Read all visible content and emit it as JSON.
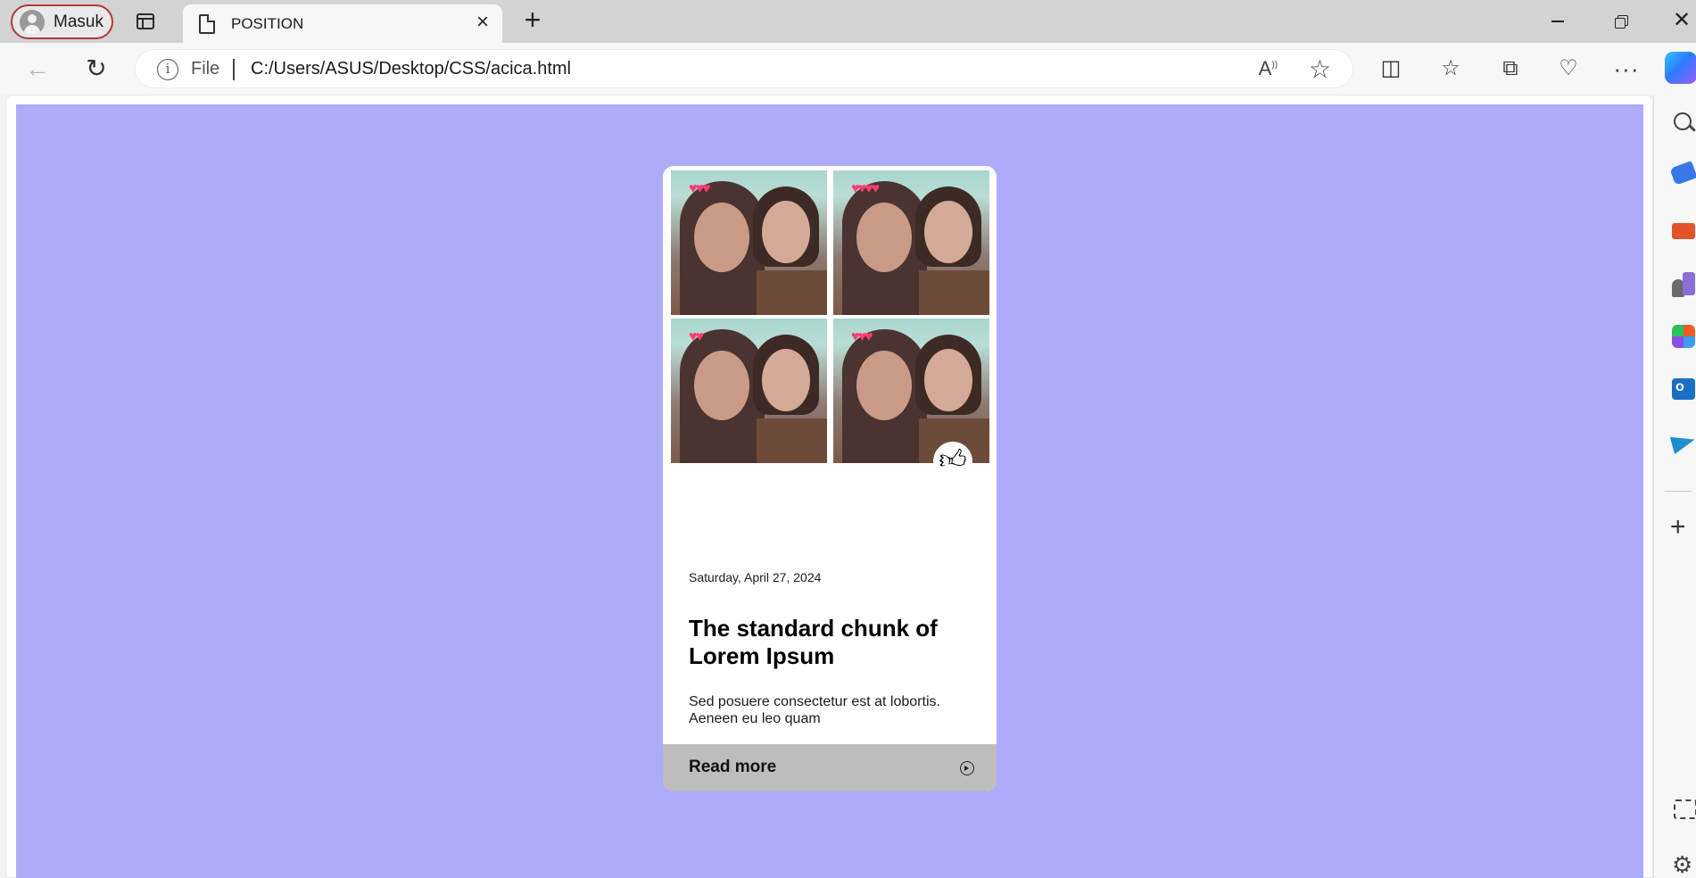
{
  "browser": {
    "profile_label": "Masuk",
    "tab_title": "POSITION",
    "address_scheme": "File",
    "address_url": "C:/Users/ASUS/Desktop/CSS/acica.html",
    "icons": [
      "profile-avatar-icon",
      "tab-actions-icon",
      "page-icon",
      "close-icon",
      "new-tab-icon",
      "back-icon",
      "refresh-icon",
      "info-icon",
      "read-aloud-icon",
      "favorite-star-icon",
      "split-screen-icon",
      "favorites-icon",
      "collections-icon",
      "browser-essentials-icon",
      "more-icon",
      "copilot-icon"
    ]
  },
  "sidebar": {
    "icons": [
      "search-icon",
      "shopping-tag-icon",
      "tools-icon",
      "games-icon",
      "office-icon",
      "outlook-icon",
      "send-icon",
      "add-icon",
      "screenshot-icon",
      "settings-icon"
    ]
  },
  "page": {
    "background_color": "#adacf8",
    "card": {
      "date": "Saturday, April 27, 2024",
      "headline": "The standard chunk of Lorem Ipsum",
      "excerpt": "Sed posuere consectetur est at lobortis. Aeneen eu leo quam",
      "read_more_label": "Read more",
      "like_icon": "thumbs-up-icon",
      "arrow_icon": "circle-arrow-right-icon",
      "photo_count": 4
    }
  }
}
